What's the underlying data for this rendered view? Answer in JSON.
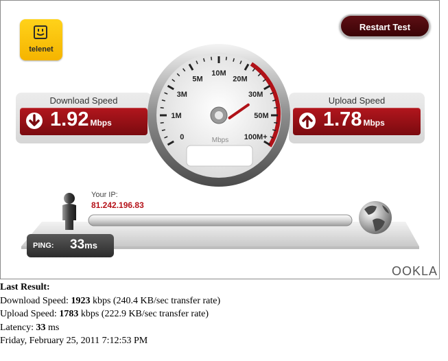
{
  "logo": {
    "brand": "telenet"
  },
  "restart": {
    "label": "Restart Test"
  },
  "download": {
    "title": "Download Speed",
    "value": "1.92",
    "unit": "Mbps"
  },
  "upload": {
    "title": "Upload Speed",
    "value": "1.78",
    "unit": "Mbps"
  },
  "gauge": {
    "ticks": [
      "0",
      "1M",
      "3M",
      "5M",
      "10M",
      "20M",
      "30M",
      "50M",
      "100M+"
    ],
    "unit": "Mbps",
    "reading_mbps": 1.92
  },
  "ip": {
    "label": "Your IP:",
    "value": "81.242.196.83"
  },
  "ping": {
    "label": "PING:",
    "value": "33",
    "unit": "ms"
  },
  "brand": {
    "ookla": "OOKLA"
  },
  "results": {
    "heading": "Last Result:",
    "download_prefix": "Download Speed: ",
    "download_value": "1923",
    "download_suffix": " kbps (240.4 KB/sec transfer rate)",
    "upload_prefix": "Upload Speed: ",
    "upload_value": "1783",
    "upload_suffix": " kbps (222.9 KB/sec transfer rate)",
    "latency_prefix": "Latency: ",
    "latency_value": "33",
    "latency_suffix": " ms",
    "timestamp": "Friday, February 25, 2011 7:12:53 PM"
  },
  "colors": {
    "accent": "#b2161d",
    "dark": "#3a0306",
    "panel": "#e0e0e0"
  }
}
